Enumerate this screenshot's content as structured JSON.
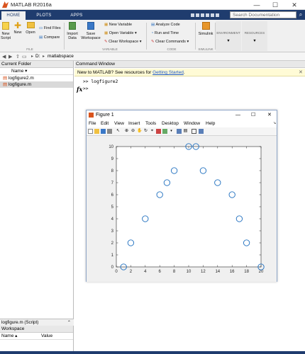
{
  "window": {
    "title": "MATLAB R2016a",
    "min": "—",
    "max": "☐",
    "close": "✕"
  },
  "tabs": [
    {
      "label": "HOME"
    },
    {
      "label": "PLOTS"
    },
    {
      "label": "APPS"
    }
  ],
  "search": {
    "placeholder": "Search Documentation",
    "icon": "search-icon"
  },
  "toolstrip": {
    "new_script": "New\nScript",
    "new": "New",
    "open": "Open",
    "find_files": "Find Files",
    "compare": "Compare",
    "import_data": "Import\nData",
    "save_workspace": "Save\nWorkspace",
    "new_variable": "New Variable",
    "open_variable": "Open Variable",
    "clear_workspace": "Clear Workspace",
    "analyze_code": "Analyze Code",
    "run_and_time": "Run and Time",
    "clear_commands": "Clear Commands",
    "simulink": "Simulink",
    "environment": "ENVIRONMENT",
    "resources": "RESOURCES",
    "sections": [
      "FILE",
      "VARIABLE",
      "CODE",
      "SIMULINK"
    ]
  },
  "addressbar": {
    "path_drive": "D:",
    "path_folder": "matlabspace",
    "sep": "▸"
  },
  "current_folder": {
    "title": "Current Folder",
    "col_name": "Name",
    "sort": "▾",
    "files": [
      {
        "name": "logfigure2.m"
      },
      {
        "name": "logfigure.m"
      }
    ]
  },
  "command_window": {
    "title": "Command Window",
    "banner_text": "New to MATLAB? See resources for ",
    "banner_link": "Getting Started",
    "banner_end": ".",
    "prompt": ">>",
    "command": "logfigure2",
    "fx": "fx"
  },
  "figure": {
    "title": "Figure 1",
    "menu": [
      "File",
      "Edit",
      "View",
      "Insert",
      "Tools",
      "Desktop",
      "Window",
      "Help"
    ],
    "controls": {
      "min": "—",
      "max": "☐",
      "close": "✕"
    }
  },
  "details": {
    "label": "logfigure.m  (Script)"
  },
  "workspace": {
    "title": "Workspace",
    "col_name": "Name",
    "col_value": "Value",
    "sort": "▴"
  },
  "chart_data": {
    "type": "scatter",
    "x": [
      1,
      2,
      4,
      6,
      7,
      8,
      10,
      11,
      12,
      14,
      16,
      17,
      18,
      20
    ],
    "y": [
      0,
      2,
      4,
      6,
      7,
      8,
      10,
      10,
      8,
      7,
      6,
      4,
      2,
      0
    ],
    "xlim": [
      0,
      20
    ],
    "ylim": [
      0,
      10
    ],
    "xticks": [
      0,
      2,
      4,
      6,
      8,
      10,
      12,
      14,
      16,
      18,
      20
    ],
    "yticks": [
      0,
      1,
      2,
      3,
      4,
      5,
      6,
      7,
      8,
      9,
      10
    ],
    "marker": "circle-open",
    "color": "#1f6fbf",
    "grid": false,
    "title": "",
    "xlabel": "",
    "ylabel": ""
  },
  "colors": {
    "accent": "#1f3c6e",
    "marker": "#1f6fbf",
    "banner": "#fffbd6"
  }
}
